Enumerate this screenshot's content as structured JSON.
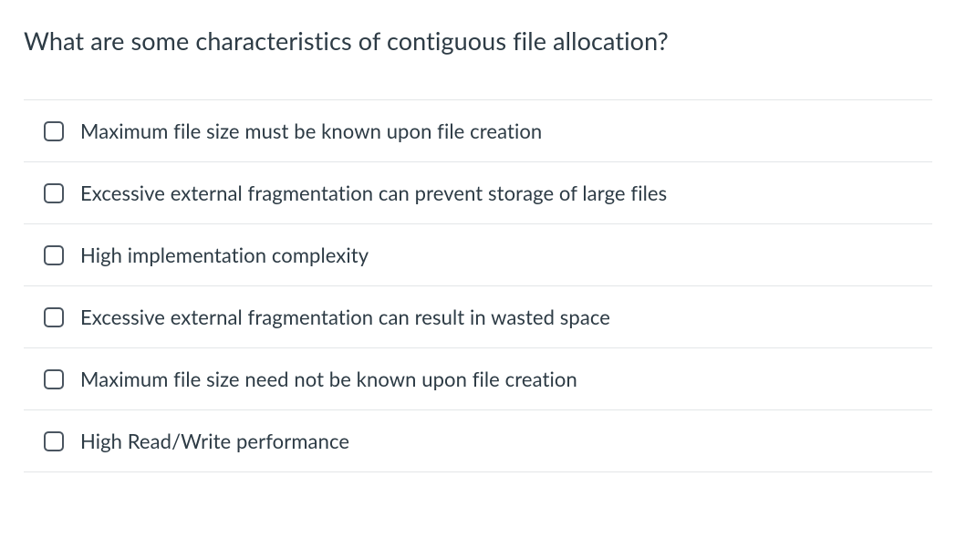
{
  "question": {
    "title": "What are some characteristics of contiguous file allocation?",
    "options": [
      {
        "label": "Maximum file size must be known upon file creation"
      },
      {
        "label": "Excessive external fragmentation can prevent storage of large files"
      },
      {
        "label": "High implementation complexity"
      },
      {
        "label": "Excessive external fragmentation can result in wasted space"
      },
      {
        "label": "Maximum file size need not be known upon file creation"
      },
      {
        "label": "High Read/Write performance"
      }
    ]
  }
}
